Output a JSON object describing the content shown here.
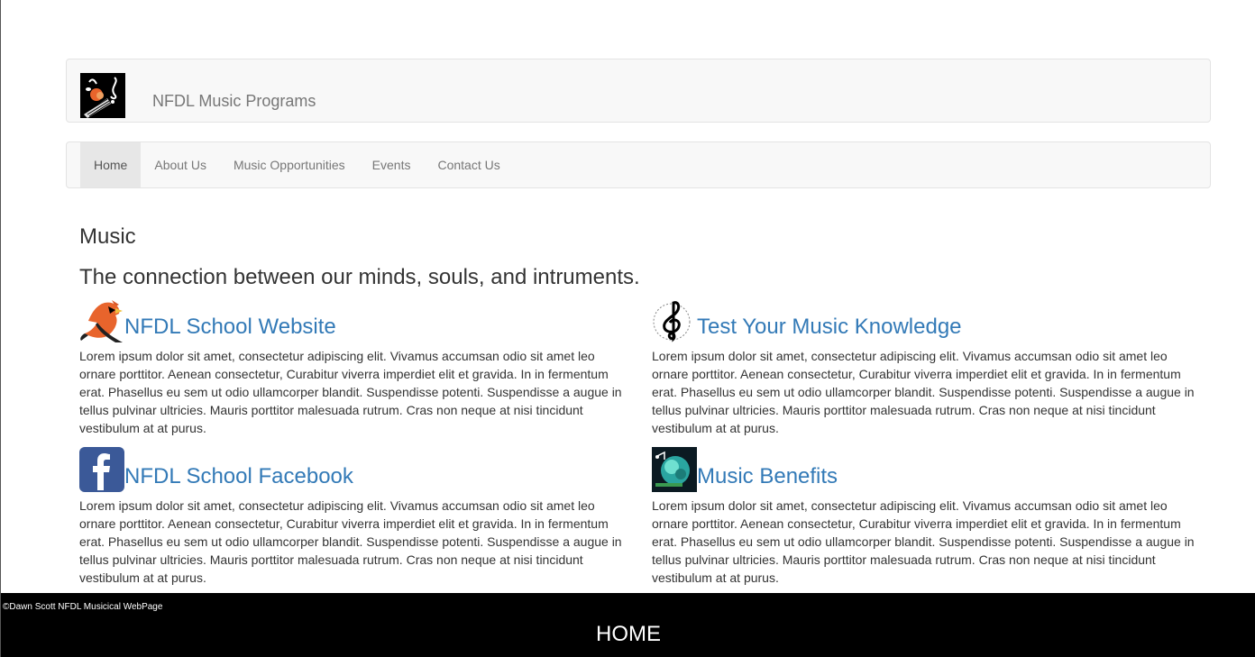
{
  "brand": {
    "title": "NFDL Music Programs",
    "logo_icon": "music-notes-logo-icon"
  },
  "nav": {
    "items": [
      {
        "label": "Home",
        "active": true
      },
      {
        "label": "About Us",
        "active": false
      },
      {
        "label": "Music Opportunities",
        "active": false
      },
      {
        "label": "Events",
        "active": false
      },
      {
        "label": "Contact Us",
        "active": false
      }
    ]
  },
  "main": {
    "heading": "Music",
    "subheading": "The connection between our minds, souls, and intruments.",
    "cards": [
      {
        "title": "NFDL School Website",
        "icon": "cardinal-bird-icon",
        "text": "Lorem ipsum dolor sit amet, consectetur adipiscing elit. Vivamus accumsan odio sit amet leo ornare porttitor. Aenean consectetur, Curabitur viverra imperdiet elit et gravida. In in fermentum erat. Phasellus eu sem ut odio ullamcorper blandit. Suspendisse potenti. Suspendisse a augue in tellus pulvinar ultricies. Mauris porttitor malesuada rutrum. Cras non neque at nisi tincidunt vestibulum at at purus."
      },
      {
        "title": "Test Your Music Knowledge",
        "icon": "treble-clef-icon",
        "text": "Lorem ipsum dolor sit amet, consectetur adipiscing elit. Vivamus accumsan odio sit amet leo ornare porttitor. Aenean consectetur, Curabitur viverra imperdiet elit et gravida. In in fermentum erat. Phasellus eu sem ut odio ullamcorper blandit. Suspendisse potenti. Suspendisse a augue in tellus pulvinar ultricies. Mauris porttitor malesuada rutrum. Cras non neque at nisi tincidunt vestibulum at at purus."
      },
      {
        "title": "NFDL School Facebook",
        "icon": "facebook-icon",
        "text": "Lorem ipsum dolor sit amet, consectetur adipiscing elit. Vivamus accumsan odio sit amet leo ornare porttitor. Aenean consectetur, Curabitur viverra imperdiet elit et gravida. In in fermentum erat. Phasellus eu sem ut odio ullamcorper blandit. Suspendisse potenti. Suspendisse a augue in tellus pulvinar ultricies. Mauris porttitor malesuada rutrum. Cras non neque at nisi tincidunt vestibulum at at purus."
      },
      {
        "title": "Music Benefits",
        "icon": "music-brain-icon",
        "text": "Lorem ipsum dolor sit amet, consectetur adipiscing elit. Vivamus accumsan odio sit amet leo ornare porttitor. Aenean consectetur, Curabitur viverra imperdiet elit et gravida. In in fermentum erat. Phasellus eu sem ut odio ullamcorper blandit. Suspendisse potenti. Suspendisse a augue in tellus pulvinar ultricies. Mauris porttitor malesuada rutrum. Cras non neque at nisi tincidunt vestibulum at at purus."
      }
    ]
  },
  "footer": {
    "copyright": "©Dawn Scott NFDL Musicical WebPage",
    "home_label": "HOME"
  },
  "colors": {
    "link": "#337ab7",
    "navbar_bg": "#f8f8f8",
    "active_nav_bg": "#e7e7e7",
    "footer_bg": "#000000"
  }
}
